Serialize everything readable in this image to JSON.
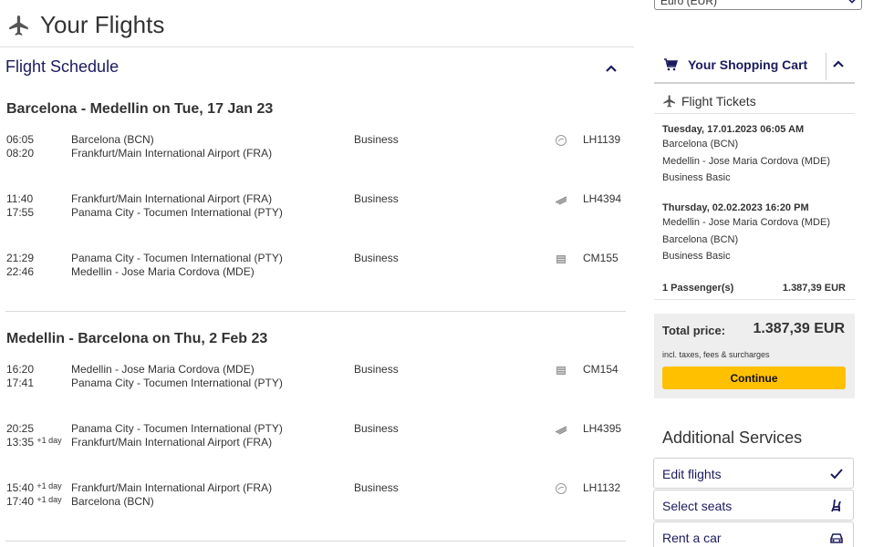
{
  "currency": {
    "selected": "Euro (EUR)"
  },
  "page": {
    "title": "Your Flights"
  },
  "schedule": {
    "title": "Flight Schedule",
    "journeys": [
      {
        "title": "Barcelona - Medellin on Tue, 17 Jan 23",
        "segments": [
          {
            "dep_time": "06:05",
            "arr_time": "08:20",
            "arr_day": "",
            "dep_day": "",
            "from": "Barcelona (BCN)",
            "to": "Frankfurt/Main International Airport (FRA)",
            "class": "Business",
            "airline_icon": "lufthansa-crane-icon",
            "flight": "LH1139"
          },
          {
            "dep_time": "11:40",
            "arr_time": "17:55",
            "arr_day": "",
            "dep_day": "",
            "from": "Frankfurt/Main International Airport (FRA)",
            "to": "Panama City - Tocumen International (PTY)",
            "class": "Business",
            "airline_icon": "partner-airline-icon",
            "flight": "LH4394"
          },
          {
            "dep_time": "21:29",
            "arr_time": "22:46",
            "arr_day": "",
            "dep_day": "",
            "from": "Panama City - Tocumen International (PTY)",
            "to": "Medellin - Jose Maria Cordova (MDE)",
            "class": "Business",
            "airline_icon": "copa-airline-icon",
            "flight": "CM155"
          }
        ]
      },
      {
        "title": "Medellin - Barcelona on Thu, 2 Feb 23",
        "segments": [
          {
            "dep_time": "16:20",
            "arr_time": "17:41",
            "arr_day": "",
            "dep_day": "",
            "from": "Medellin - Jose Maria Cordova (MDE)",
            "to": "Panama City - Tocumen International (PTY)",
            "class": "Business",
            "airline_icon": "copa-airline-icon",
            "flight": "CM154"
          },
          {
            "dep_time": "20:25",
            "arr_time": "13:35",
            "arr_day": "+1 day",
            "dep_day": "",
            "from": "Panama City - Tocumen International (PTY)",
            "to": "Frankfurt/Main International Airport (FRA)",
            "class": "Business",
            "airline_icon": "partner-airline-icon",
            "flight": "LH4395"
          },
          {
            "dep_time": "15:40",
            "arr_time": "17:40",
            "arr_day": "+1 day",
            "dep_day": "+1 day",
            "from": "Frankfurt/Main International Airport (FRA)",
            "to": "Barcelona (BCN)",
            "class": "Business",
            "airline_icon": "lufthansa-crane-icon",
            "flight": "LH1132"
          }
        ]
      }
    ]
  },
  "cart": {
    "title": "Your Shopping Cart",
    "tickets_label": "Flight Tickets",
    "trips": [
      {
        "datetime": "Tuesday, 17.01.2023 06:05 AM",
        "from": "Barcelona (BCN)",
        "to": "Medellin - Jose Maria Cordova (MDE)",
        "fare": "Business Basic"
      },
      {
        "datetime": "Thursday, 02.02.2023 16:20 PM",
        "from": "Medellin - Jose Maria Cordova (MDE)",
        "to": "Barcelona (BCN)",
        "fare": "Business Basic"
      }
    ],
    "passengers": "1 Passenger(s)",
    "passengers_price": "1.387,39 EUR",
    "total_label": "Total price:",
    "total_amount": "1.387,39 EUR",
    "total_note": "incl. taxes, fees & surcharges",
    "continue_label": "Continue"
  },
  "additional": {
    "title": "Additional Services",
    "items": [
      {
        "label": "Edit flights",
        "icon": "check-icon"
      },
      {
        "label": "Select seats",
        "icon": "seat-icon"
      },
      {
        "label": "Rent a car",
        "icon": "car-icon"
      }
    ]
  },
  "colors": {
    "accent": "#1b1b5e",
    "cta": "#ffc000",
    "panel": "#eeeeee"
  }
}
